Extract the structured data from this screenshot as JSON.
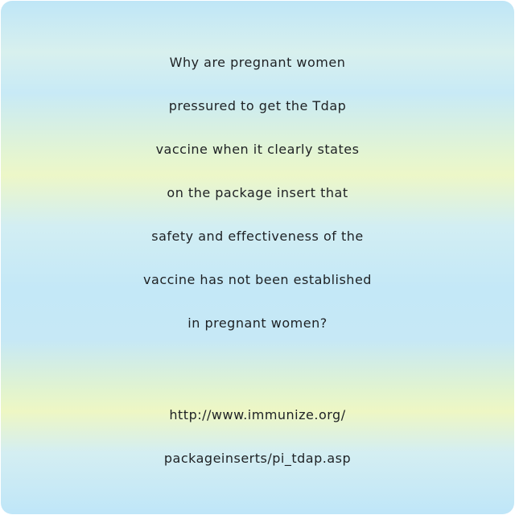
{
  "question_lines": [
    "Why are pregnant women",
    "pressured to get the Tdap",
    "vaccine when it clearly states",
    "on the package insert that",
    "safety and effectiveness of the",
    "vaccine has not been established",
    "in pregnant women?"
  ],
  "link_lines": [
    "http://www.immunize.org/",
    "packageinserts/pi_tdap.asp"
  ]
}
